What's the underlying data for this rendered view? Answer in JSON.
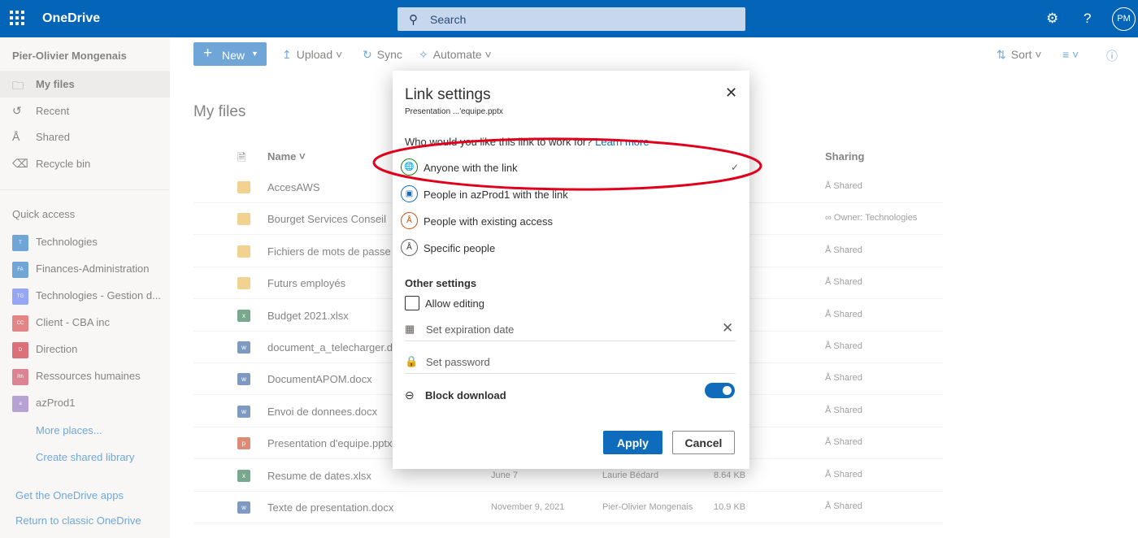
{
  "topbar": {
    "app_name": "OneDrive",
    "search_placeholder": "Search",
    "avatar_initials": "PM",
    "icons": [
      "waffle-icon",
      "search-icon",
      "gear-icon",
      "help-icon"
    ]
  },
  "sidebar": {
    "user": "Pier-Olivier Mongenais",
    "nav": [
      {
        "label": "My files",
        "icon": "folder-icon"
      },
      {
        "label": "Recent",
        "icon": "clock-icon"
      },
      {
        "label": "Shared",
        "icon": "people-icon"
      },
      {
        "label": "Recycle bin",
        "icon": "trash-icon"
      }
    ],
    "quick_access_title": "Quick access",
    "quick_access": [
      {
        "label": "Technologies",
        "initials": "T",
        "color": "#0f6cbd"
      },
      {
        "label": "Finances-Administration",
        "initials": "FA",
        "color": "#0f6cbd"
      },
      {
        "label": "Technologies - Gestion d...",
        "initials": "TG",
        "color": "#4f6bed"
      },
      {
        "label": "Client - CBA inc",
        "initials": "CC",
        "color": "#d13438"
      },
      {
        "label": "Direction",
        "initials": "D",
        "color": "#c50f1f"
      },
      {
        "label": "Ressources humaines",
        "initials": "Rh",
        "color": "#c4314b"
      },
      {
        "label": "azProd1",
        "initials": "a",
        "color": "#8764b8"
      }
    ],
    "more_places": "More places...",
    "create_library": "Create shared library",
    "get_apps": "Get the OneDrive apps",
    "return_classic": "Return to classic OneDrive"
  },
  "commands": {
    "new": "New",
    "upload": "Upload",
    "sync": "Sync",
    "automate": "Automate",
    "sort": "Sort"
  },
  "main": {
    "title": "My files",
    "col_name": "Name",
    "col_sharing": "Sharing",
    "files": [
      {
        "name": "AccesAWS",
        "type": "folder",
        "date": "",
        "by": "",
        "size": "",
        "sharing": "Shared"
      },
      {
        "name": "Bourget Services Conseil",
        "type": "folder",
        "date": "",
        "by": "",
        "size": "",
        "sharing": "Owner: Technologies"
      },
      {
        "name": "Fichiers de mots de passe",
        "type": "folder",
        "date": "",
        "by": "",
        "size": "",
        "sharing": "Shared"
      },
      {
        "name": "Futurs employés",
        "type": "folder",
        "date": "",
        "by": "",
        "size": "",
        "sharing": "Shared"
      },
      {
        "name": "Budget 2021.xlsx",
        "type": "excel",
        "date": "",
        "by": "",
        "size": "",
        "sharing": "Shared"
      },
      {
        "name": "document_a_telecharger.docx",
        "type": "word",
        "date": "",
        "by": "",
        "size": "",
        "sharing": "Shared"
      },
      {
        "name": "DocumentAPOM.docx",
        "type": "word",
        "date": "",
        "by": "",
        "size": "",
        "sharing": "Shared"
      },
      {
        "name": "Envoi de donnees.docx",
        "type": "word",
        "date": "",
        "by": "",
        "size": "",
        "sharing": "Shared"
      },
      {
        "name": "Presentation d'equipe.pptx",
        "type": "ppt",
        "date": "",
        "by": "",
        "size": "",
        "sharing": "Shared"
      },
      {
        "name": "Resume de dates.xlsx",
        "type": "excel",
        "date": "June 7",
        "by": "Laurie Bédard",
        "size": "8.64 KB",
        "sharing": "Shared"
      },
      {
        "name": "Texte de presentation.docx",
        "type": "word",
        "date": "November 9, 2021",
        "by": "Pier-Olivier Mongenais",
        "size": "10.9 KB",
        "sharing": "Shared"
      }
    ]
  },
  "dialog": {
    "title": "Link settings",
    "subtitle": "Presentation ...'equipe.pptx",
    "question": "Who would you like this link to work for?",
    "learn_more": "Learn more",
    "options": [
      {
        "label": "Anyone with the link",
        "icon": "globe-icon",
        "selected": true
      },
      {
        "label": "People in azProd1 with the link",
        "icon": "briefcase-icon",
        "selected": false
      },
      {
        "label": "People with existing access",
        "icon": "people-access-icon",
        "selected": false
      },
      {
        "label": "Specific people",
        "icon": "specific-people-icon",
        "selected": false
      }
    ],
    "other_settings": "Other settings",
    "allow_editing": "Allow editing",
    "expiration": "Set expiration date",
    "password": "Set password",
    "block_download": "Block download",
    "block_download_on": true,
    "apply": "Apply",
    "cancel": "Cancel",
    "accent_color": "#0f6cbd",
    "annotation_color": "#e0001b"
  }
}
